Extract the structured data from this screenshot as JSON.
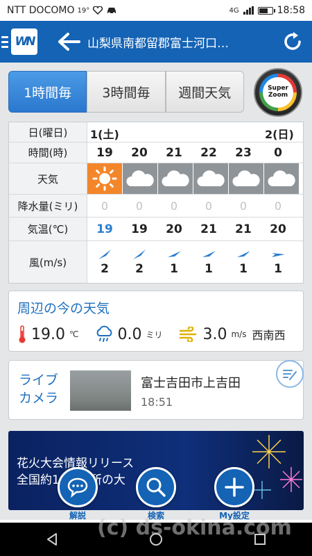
{
  "status_bar": {
    "carrier": "NTT DOCOMO",
    "temp_badge": "19°",
    "network": "4G",
    "time": "18:58"
  },
  "header": {
    "title": "山梨県南都留郡富士河口…",
    "logo_text": "WN"
  },
  "tabs": [
    {
      "label": "1時間毎",
      "active": true
    },
    {
      "label": "3時間毎",
      "active": false
    },
    {
      "label": "週間天気",
      "active": false
    }
  ],
  "super_zoom": {
    "line1": "Super",
    "line2": "Zoom"
  },
  "forecast": {
    "labels": {
      "date": "日(曜日)",
      "hour": "時間(時)",
      "weather": "天気",
      "precip": "降水量(ミリ)",
      "temp": "気温(℃)",
      "wind": "風(m/s)"
    },
    "dates": [
      "1(土)",
      "2(日)"
    ],
    "hours": [
      "19",
      "20",
      "21",
      "22",
      "23",
      "0"
    ],
    "weather": [
      "sunny-icon",
      "cloudy-icon",
      "cloudy-icon",
      "cloudy-icon",
      "cloudy-icon",
      "cloudy-icon"
    ],
    "precip": [
      "0",
      "0",
      "0",
      "0",
      "0",
      "0"
    ],
    "temps": [
      "19",
      "19",
      "20",
      "21",
      "21",
      "20"
    ],
    "winds": [
      "2",
      "2",
      "1",
      "1",
      "1",
      "1"
    ]
  },
  "current": {
    "title": "周辺の今の天気",
    "temp": "19.0",
    "temp_unit": "℃",
    "rain": "0.0",
    "rain_unit": "ミリ",
    "wind": "3.0",
    "wind_unit": "m/s",
    "wind_dir": "西南西"
  },
  "live_camera": {
    "title_line1": "ライブ",
    "title_line2": "カメラ",
    "place": "富士吉田市上吉田",
    "time": "18:51"
  },
  "banner": {
    "line1": "花火大会情報リリース",
    "line2_left": "全国約1",
    "line2_mid": "所の大",
    "line2_right": "を"
  },
  "bottom_actions": [
    {
      "label": "解説",
      "icon": "speech-bubble-icon"
    },
    {
      "label": "検索",
      "icon": "search-icon"
    },
    {
      "label": "My設定",
      "icon": "plus-icon"
    }
  ],
  "watermark": "(c) ds-okina.com",
  "colors": {
    "brand": "#1463b5",
    "accent_text": "#1f6fbf",
    "sunny": "#f4862a",
    "cloudy": "#8f9498",
    "now_temp": "#2b7fd0"
  }
}
